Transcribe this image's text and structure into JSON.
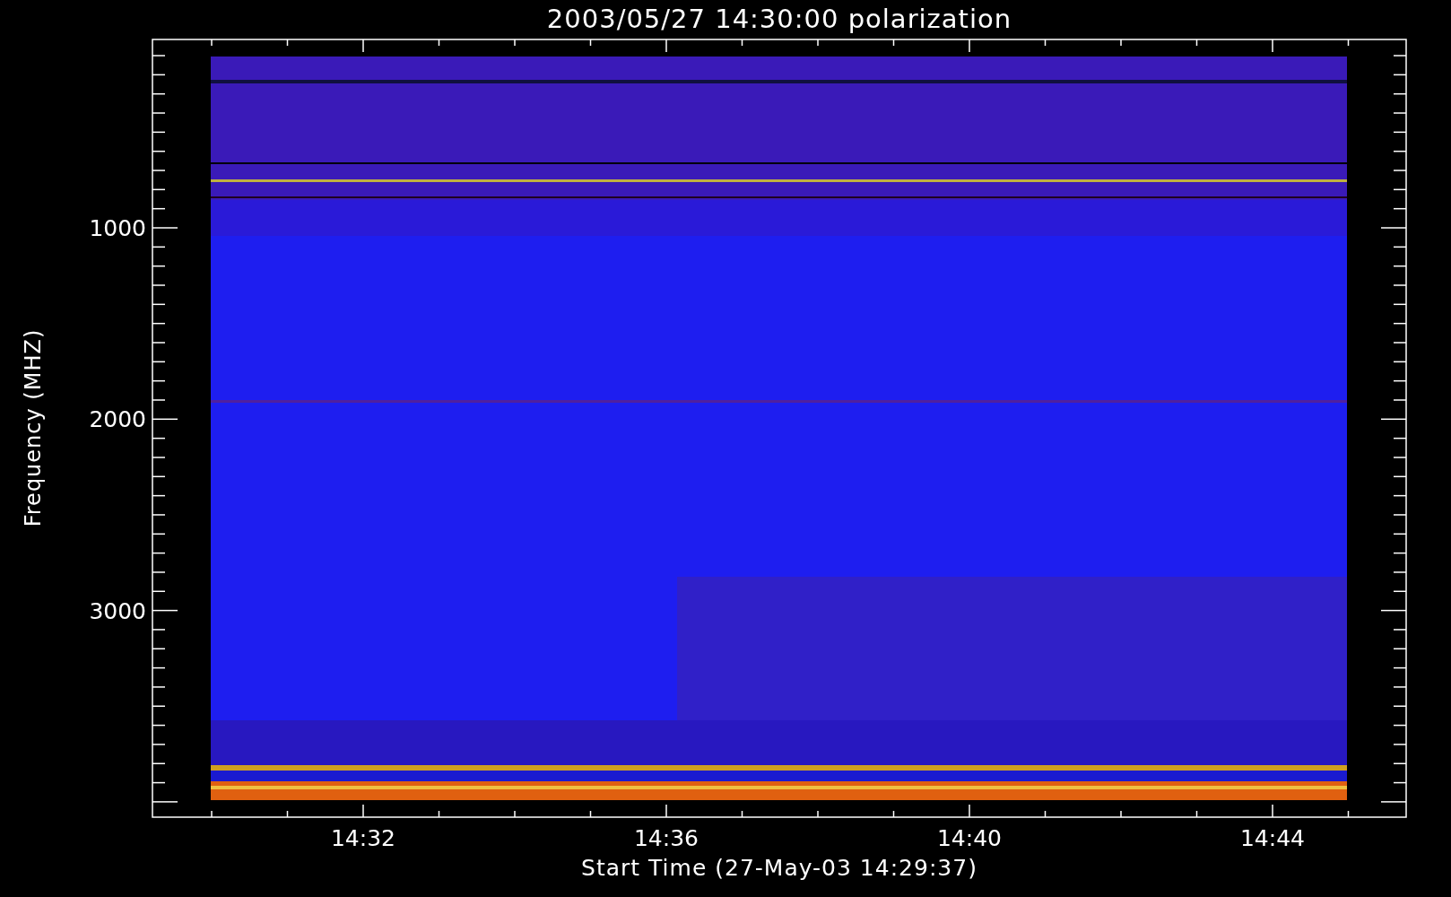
{
  "plot": {
    "title": "2003/05/27 14:30:00 polarization",
    "y_axis": {
      "label": "Frequency (MHZ)",
      "ticks": [
        "1000",
        "2000",
        "3000"
      ]
    },
    "x_axis": {
      "label": "Start Time (27-May-03 14:29:37)",
      "ticks": [
        "14:32",
        "14:36",
        "14:40",
        "14:44"
      ]
    }
  }
}
